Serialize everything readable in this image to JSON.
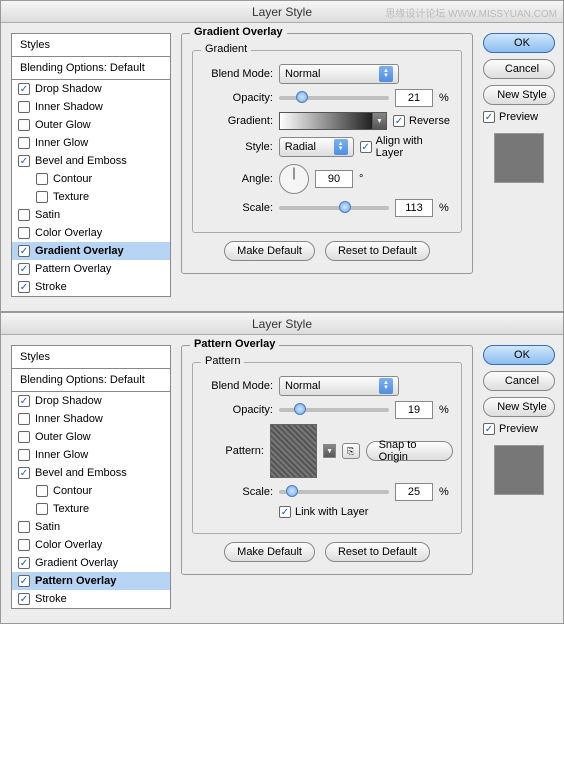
{
  "dialogs": [
    {
      "title": "Layer Style",
      "section_title": "Gradient Overlay",
      "inner_title": "Gradient",
      "styles_header": "Styles",
      "blending": "Blending Options: Default",
      "style_items": [
        {
          "label": "Drop Shadow",
          "checked": true,
          "selected": false,
          "sub": false
        },
        {
          "label": "Inner Shadow",
          "checked": false,
          "selected": false,
          "sub": false
        },
        {
          "label": "Outer Glow",
          "checked": false,
          "selected": false,
          "sub": false
        },
        {
          "label": "Inner Glow",
          "checked": false,
          "selected": false,
          "sub": false
        },
        {
          "label": "Bevel and Emboss",
          "checked": true,
          "selected": false,
          "sub": false
        },
        {
          "label": "Contour",
          "checked": false,
          "selected": false,
          "sub": true
        },
        {
          "label": "Texture",
          "checked": false,
          "selected": false,
          "sub": true
        },
        {
          "label": "Satin",
          "checked": false,
          "selected": false,
          "sub": false
        },
        {
          "label": "Color Overlay",
          "checked": false,
          "selected": false,
          "sub": false
        },
        {
          "label": "Gradient Overlay",
          "checked": true,
          "selected": true,
          "sub": false
        },
        {
          "label": "Pattern Overlay",
          "checked": true,
          "selected": false,
          "sub": false
        },
        {
          "label": "Stroke",
          "checked": true,
          "selected": false,
          "sub": false
        }
      ],
      "labels": {
        "blend_mode": "Blend Mode:",
        "opacity": "Opacity:",
        "gradient": "Gradient:",
        "style": "Style:",
        "angle": "Angle:",
        "scale": "Scale:"
      },
      "values": {
        "blend_mode": "Normal",
        "opacity": "21",
        "opacity_pct": 21,
        "style": "Radial",
        "angle": "90",
        "scale": "113",
        "scale_pct": 60,
        "reverse": "Reverse",
        "align": "Align with Layer",
        "reverse_checked": true,
        "align_checked": true
      },
      "buttons": {
        "make_default": "Make Default",
        "reset": "Reset to Default",
        "ok": "OK",
        "cancel": "Cancel",
        "new_style": "New Style",
        "preview": "Preview"
      },
      "unit_pct": "%",
      "unit_deg": "°"
    },
    {
      "title": "Layer Style",
      "section_title": "Pattern Overlay",
      "inner_title": "Pattern",
      "styles_header": "Styles",
      "blending": "Blending Options: Default",
      "style_items": [
        {
          "label": "Drop Shadow",
          "checked": true,
          "selected": false,
          "sub": false
        },
        {
          "label": "Inner Shadow",
          "checked": false,
          "selected": false,
          "sub": false
        },
        {
          "label": "Outer Glow",
          "checked": false,
          "selected": false,
          "sub": false
        },
        {
          "label": "Inner Glow",
          "checked": false,
          "selected": false,
          "sub": false
        },
        {
          "label": "Bevel and Emboss",
          "checked": true,
          "selected": false,
          "sub": false
        },
        {
          "label": "Contour",
          "checked": false,
          "selected": false,
          "sub": true
        },
        {
          "label": "Texture",
          "checked": false,
          "selected": false,
          "sub": true
        },
        {
          "label": "Satin",
          "checked": false,
          "selected": false,
          "sub": false
        },
        {
          "label": "Color Overlay",
          "checked": false,
          "selected": false,
          "sub": false
        },
        {
          "label": "Gradient Overlay",
          "checked": true,
          "selected": false,
          "sub": false
        },
        {
          "label": "Pattern Overlay",
          "checked": true,
          "selected": true,
          "sub": false
        },
        {
          "label": "Stroke",
          "checked": true,
          "selected": false,
          "sub": false
        }
      ],
      "labels": {
        "blend_mode": "Blend Mode:",
        "opacity": "Opacity:",
        "pattern": "Pattern:",
        "scale": "Scale:"
      },
      "values": {
        "blend_mode": "Normal",
        "opacity": "19",
        "opacity_pct": 19,
        "scale": "25",
        "scale_pct": 12,
        "snap": "Snap to Origin",
        "link": "Link with Layer",
        "link_checked": true
      },
      "buttons": {
        "make_default": "Make Default",
        "reset": "Reset to Default",
        "ok": "OK",
        "cancel": "Cancel",
        "new_style": "New Style",
        "preview": "Preview"
      },
      "unit_pct": "%"
    }
  ],
  "watermark": "思缘设计论坛  WWW.MISSYUAN.COM"
}
